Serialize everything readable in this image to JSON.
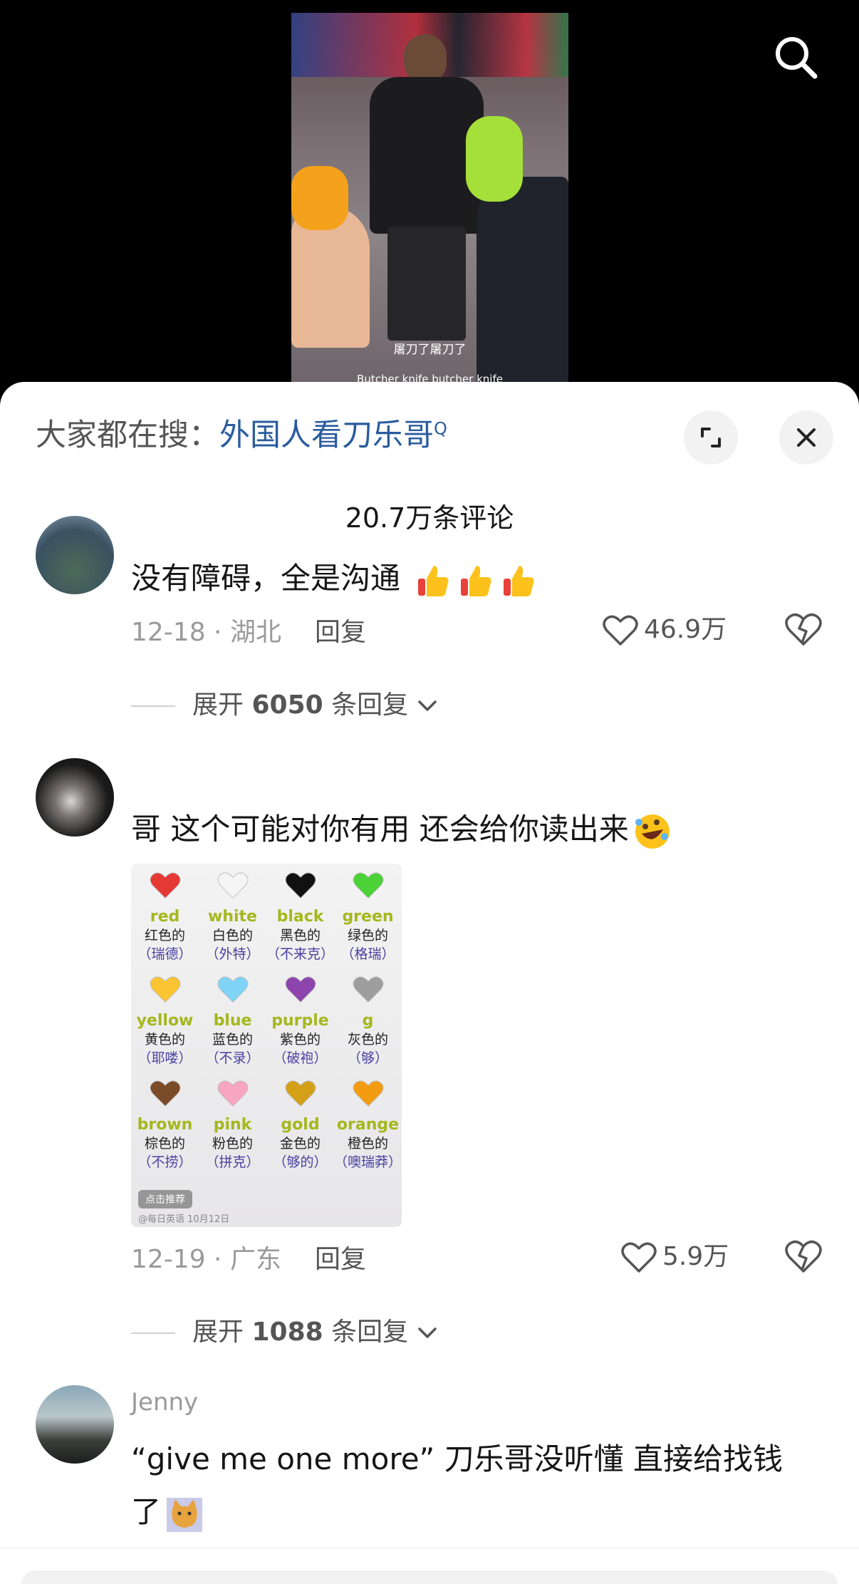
{
  "video": {
    "subtitle_cn": "屠刀了屠刀了",
    "subtitle_en": "Butcher knife butcher knife"
  },
  "hot_search": {
    "prefix": "大家都在搜：",
    "keyword": "外国人看刀乐哥",
    "search_mark": "Q"
  },
  "comments_count": "20.7万条评论",
  "comments": [
    {
      "text": "没有障碍，全是沟通",
      "emoji": [
        "thumbs-up-icon",
        "thumbs-up-icon",
        "thumbs-up-icon"
      ],
      "date": "12-18",
      "location": "湖北",
      "reply_label": "回复",
      "likes": "46.9万",
      "expand_label": "展开",
      "expand_count": "6050",
      "expand_suffix": "条回复"
    },
    {
      "text": "哥 这个可能对你有用 还会给你读出来",
      "emoji": [
        "rolling-laughing-icon"
      ],
      "date": "12-19",
      "location": "广东",
      "reply_label": "回复",
      "likes": "5.9万",
      "expand_label": "展开",
      "expand_count": "1088",
      "expand_suffix": "条回复",
      "image": {
        "colors": [
          {
            "heart": "#e53935",
            "en": "red",
            "cn": "红色的",
            "pr": "（瑞德）"
          },
          {
            "heart": "#f5f5f5",
            "en": "white",
            "cn": "白色的",
            "pr": "（外特）"
          },
          {
            "heart": "#111111",
            "en": "black",
            "cn": "黑色的",
            "pr": "（不来克）"
          },
          {
            "heart": "#4cd137",
            "en": "green",
            "cn": "绿色的",
            "pr": "（格瑞）"
          },
          {
            "heart": "#fbc531",
            "en": "yellow",
            "cn": "黄色的",
            "pr": "（耶喽）"
          },
          {
            "heart": "#7fd3f7",
            "en": "blue",
            "cn": "蓝色的",
            "pr": "（不录）"
          },
          {
            "heart": "#8e44ad",
            "en": "purple",
            "cn": "紫色的",
            "pr": "（破袍）"
          },
          {
            "heart": "#9e9e9e",
            "en": "g",
            "cn": "灰色的",
            "pr": "（够）"
          },
          {
            "heart": "#7b4a26",
            "en": "brown",
            "cn": "棕色的",
            "pr": "（不捞）"
          },
          {
            "heart": "#f8a5c2",
            "en": "pink",
            "cn": "粉色的",
            "pr": "（拼克）"
          },
          {
            "heart": "#d4a017",
            "en": "gold",
            "cn": "金色的",
            "pr": "（够的）"
          },
          {
            "heart": "#f39c12",
            "en": "orange",
            "cn": "橙色的",
            "pr": "（噢瑞莽）"
          }
        ],
        "recommend_label": "点击推荐",
        "source": "@每日英语",
        "source_date": "10月12日"
      }
    },
    {
      "username": "Jenny",
      "text_line1": "“give me one more” 刀乐哥没听懂 直接给找钱",
      "text_line2": "了",
      "emoji": [
        "cat-icon"
      ]
    }
  ]
}
